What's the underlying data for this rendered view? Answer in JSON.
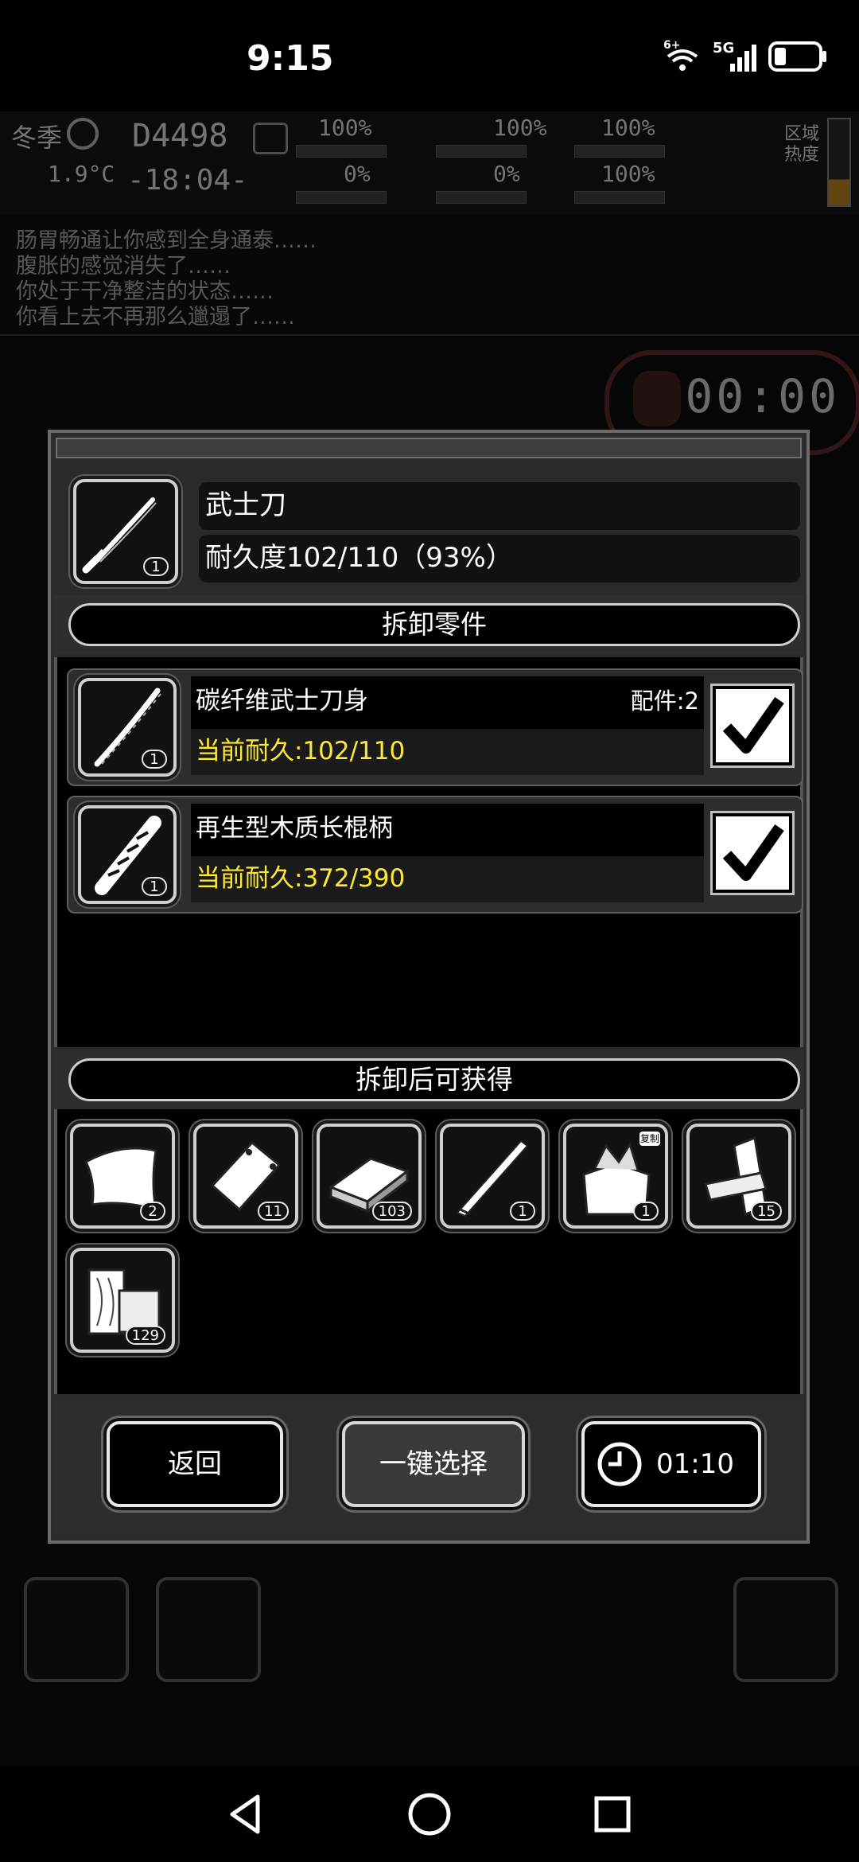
{
  "status_bar": {
    "time": "9:15",
    "network": "5G",
    "wifi_badge": "6+"
  },
  "background": {
    "hud": {
      "season": "冬季",
      "temperature": "1.9°C",
      "day": "D4498",
      "clock": "-18:04-",
      "stats": [
        "100%",
        "0%",
        "100%",
        "0%",
        "0%",
        "100%",
        "100%"
      ],
      "zone_label": "区域热度"
    },
    "log_lines": [
      "肠胃畅通让你感到全身通泰……",
      "腹胀的感觉消失了……",
      "你处于干净整洁的状态……",
      "你看上去不再那么邋遢了……"
    ],
    "timer": "00:00"
  },
  "dialog": {
    "item": {
      "name": "武士刀",
      "durability": "耐久度102/110（93%）",
      "count": "1",
      "icon": "katana-icon"
    },
    "parts_title": "拆卸零件",
    "parts": [
      {
        "name": "碳纤维武士刀身",
        "extra": "配件:2",
        "durability": "当前耐久:102/110",
        "count": "1",
        "icon": "blade-icon",
        "checked": true
      },
      {
        "name": "再生型木质长棍柄",
        "extra": "",
        "durability": "当前耐久:372/390",
        "count": "1",
        "icon": "handle-icon",
        "checked": true
      }
    ],
    "gain_title": "拆卸后可获得",
    "gains": [
      {
        "icon": "cloth-icon",
        "count": "2"
      },
      {
        "icon": "plate-icon",
        "count": "11"
      },
      {
        "icon": "ingot-icon",
        "count": "103"
      },
      {
        "icon": "knife-blade-icon",
        "count": "1"
      },
      {
        "icon": "scrap-bag-icon",
        "count": "1",
        "tag": "复制"
      },
      {
        "icon": "planks-icon",
        "count": "15"
      },
      {
        "icon": "wood-log-icon",
        "count": "129"
      }
    ],
    "footer": {
      "back_label": "返回",
      "select_all_label": "一键选择",
      "time_label": "01:10"
    }
  },
  "colors": {
    "durability_text": "#ffea2e",
    "dialog_bg": "#2b2b2b",
    "check_bg": "#ffffff"
  }
}
